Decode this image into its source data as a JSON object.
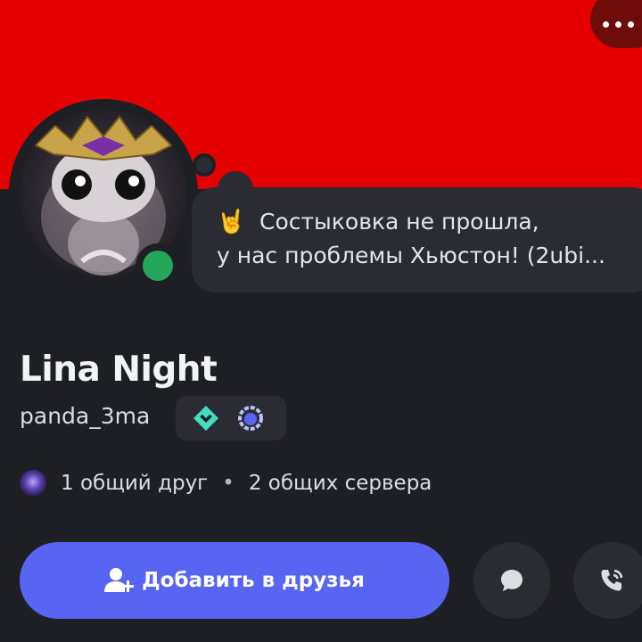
{
  "banner": {
    "color": "#e50000"
  },
  "header": {
    "more_icon": "more-horizontal-icon"
  },
  "profile": {
    "display_name": "Lina Night",
    "username": "panda_3ma",
    "status_online_color": "#23a55a",
    "custom_status": {
      "emoji": "🤘",
      "line1": "Состыковка не прошла,",
      "line2": "у нас проблемы Хьюстон! (2ubi..."
    },
    "badges": [
      "hypesquad-balance-badge",
      "laurel-wreath-badge"
    ]
  },
  "mutuals": {
    "friends": "1 общий друг",
    "separator": "•",
    "servers": "2 общих сервера"
  },
  "actions": {
    "add_friend_label": "Добавить в друзья",
    "add_friend_color": "#5865f2",
    "message_icon": "message-bubble-icon",
    "call_icon": "phone-call-icon"
  }
}
